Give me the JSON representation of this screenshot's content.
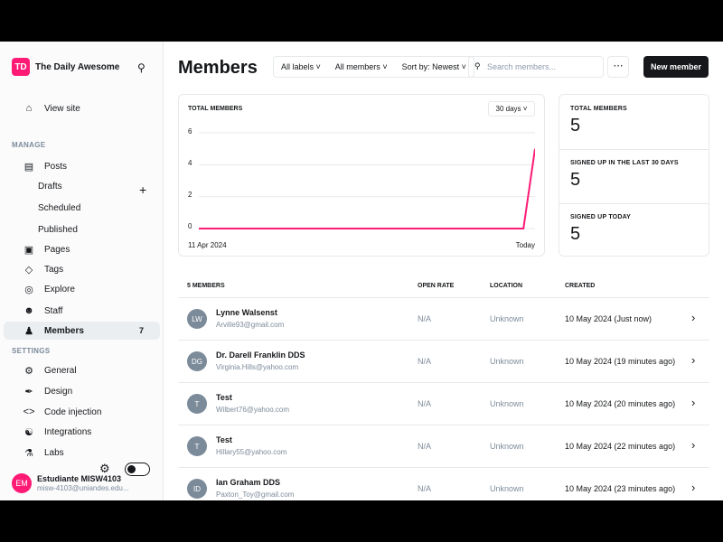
{
  "site": {
    "logo_initials": "TD",
    "name": "The Daily Awesome"
  },
  "sidebar": {
    "view_site": "View site",
    "manage_label": "MANAGE",
    "posts": "Posts",
    "drafts": "Drafts",
    "scheduled": "Scheduled",
    "published": "Published",
    "pages": "Pages",
    "tags": "Tags",
    "explore": "Explore",
    "staff": "Staff",
    "members": "Members",
    "members_count": "7",
    "settings_label": "SETTINGS",
    "general": "General",
    "design": "Design",
    "code_injection": "Code injection",
    "integrations": "Integrations",
    "labs": "Labs"
  },
  "user": {
    "initials": "EM",
    "name": "Estudiante MISW4103",
    "email": "misw-4103@uniandes.edu..."
  },
  "header": {
    "title": "Members",
    "filter_labels": "All labels",
    "filter_members": "All members",
    "sort": "Sort by: Newest",
    "search_placeholder": "Search members...",
    "new_member": "New member"
  },
  "chart_card": {
    "label": "TOTAL MEMBERS",
    "range": "30 days",
    "start_date": "11 Apr 2024",
    "end_date": "Today"
  },
  "chart_data": {
    "type": "line",
    "x": [
      "11 Apr 2024",
      "Today"
    ],
    "yticks": [
      "6",
      "4",
      "2",
      "0"
    ],
    "ylim": [
      0,
      6
    ],
    "series": [
      {
        "values": [
          0,
          0,
          0,
          0,
          0,
          0,
          0,
          0,
          0,
          0,
          0,
          0,
          0,
          0,
          0,
          0,
          0,
          0,
          0,
          0,
          0,
          0,
          0,
          0,
          0,
          0,
          0,
          0,
          0,
          5
        ]
      }
    ],
    "xlabel": "",
    "ylabel": ""
  },
  "stats": [
    {
      "label": "TOTAL MEMBERS",
      "value": "5"
    },
    {
      "label": "SIGNED UP IN THE LAST 30 DAYS",
      "value": "5"
    },
    {
      "label": "SIGNED UP TODAY",
      "value": "5"
    }
  ],
  "table": {
    "count_label": "5 MEMBERS",
    "col_open_rate": "OPEN RATE",
    "col_location": "LOCATION",
    "col_created": "CREATED",
    "rows": [
      {
        "initials": "LW",
        "name": "Lynne Walsenst",
        "email": "Arville93@gmail.com",
        "open_rate": "N/A",
        "location": "Unknown",
        "created": "10 May 2024 (Just now)"
      },
      {
        "initials": "DG",
        "name": "Dr. Darell Franklin DDS",
        "email": "Virginia.Hills@yahoo.com",
        "open_rate": "N/A",
        "location": "Unknown",
        "created": "10 May 2024 (19 minutes ago)"
      },
      {
        "initials": "T",
        "name": "Test",
        "email": "Wilbert76@yahoo.com",
        "open_rate": "N/A",
        "location": "Unknown",
        "created": "10 May 2024 (20 minutes ago)"
      },
      {
        "initials": "T",
        "name": "Test",
        "email": "Hillary55@yahoo.com",
        "open_rate": "N/A",
        "location": "Unknown",
        "created": "10 May 2024 (22 minutes ago)"
      },
      {
        "initials": "ID",
        "name": "Ian Graham DDS",
        "email": "Paxton_Toy@gmail.com",
        "open_rate": "N/A",
        "location": "Unknown",
        "created": "10 May 2024 (23 minutes ago)"
      }
    ]
  },
  "colors": {
    "accent": "#ff1a75",
    "text": "#15171a",
    "muted": "#7c8b9a",
    "border": "#e6e9eb"
  }
}
